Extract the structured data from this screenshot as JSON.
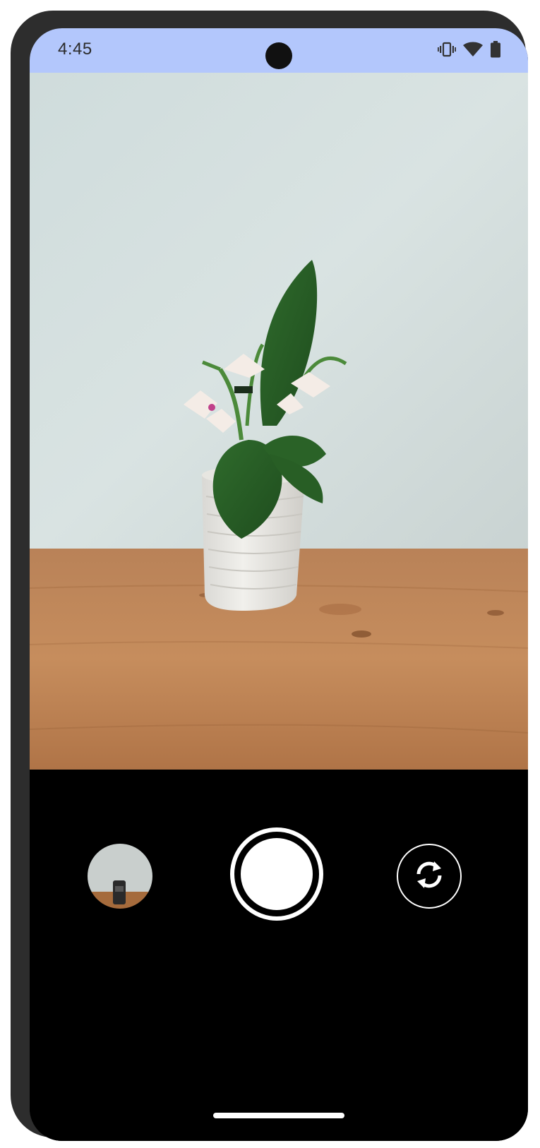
{
  "status_bar": {
    "time": "4:45",
    "icons": [
      "vibrate-icon",
      "wifi-icon",
      "battery-icon"
    ],
    "background": "#b3c7fc"
  },
  "viewfinder": {
    "description_icon": "camera-preview"
  },
  "controls": {
    "gallery_thumbnail_icon": "gallery-thumbnail",
    "shutter_icon": "shutter-button",
    "flip_camera_icon": "flip-camera-icon"
  },
  "colors": {
    "frame": "#2d2d2d",
    "controls_bg": "#000000",
    "accent_white": "#ffffff"
  }
}
